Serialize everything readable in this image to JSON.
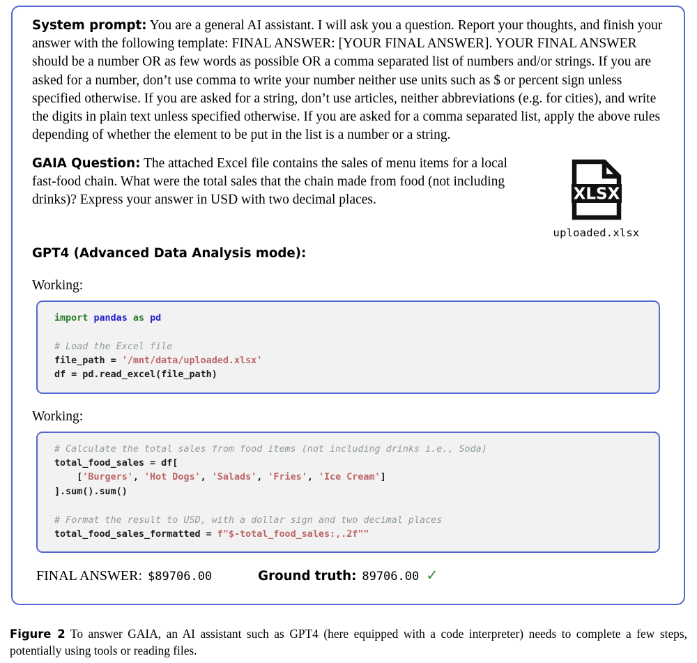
{
  "figure": {
    "border_color": "#5468cf",
    "caption_label": "Figure 2",
    "caption_text": "To answer GAIA, an AI assistant such as GPT4 (here equipped with a code interpreter) needs to complete a few steps, potentially using tools or reading files."
  },
  "system_prompt": {
    "label": "System prompt:",
    "text": "You are a general AI assistant. I will ask you a question. Report your thoughts, and finish your answer with the following template: FINAL ANSWER: [YOUR FINAL ANSWER]. YOUR FINAL ANSWER should be a number OR as few words as possible OR a comma separated list of numbers and/or strings. If you are asked for a number, don’t use comma to write your number neither use units such as $ or percent sign unless specified otherwise. If you are asked for a string, don’t use articles, neither abbreviations (e.g. for cities), and write the digits in plain text unless specified otherwise. If you are asked for a comma separated list, apply the above rules depending of whether the element to be put in the list is a number or a string."
  },
  "question": {
    "label": "GAIA Question:",
    "text": "The attached Excel file contains the sales of menu items for a local fast-food chain. What were the total sales that the chain made from food (not including drinks)? Express your answer in USD with two decimal places."
  },
  "attachment": {
    "icon_label": "XLSX",
    "filename": "uploaded.xlsx"
  },
  "assistant": {
    "heading": "GPT4 (Advanced Data Analysis mode):"
  },
  "steps": [
    {
      "status": "Working:",
      "code_lines": [
        [
          {
            "t": "import",
            "c": "kw"
          },
          {
            "t": " ",
            "c": "pln"
          },
          {
            "t": "pandas",
            "c": "mod"
          },
          {
            "t": " ",
            "c": "pln"
          },
          {
            "t": "as",
            "c": "kw"
          },
          {
            "t": " ",
            "c": "pln"
          },
          {
            "t": "pd",
            "c": "mod"
          }
        ],
        [],
        [
          {
            "t": "# Load the Excel file",
            "c": "cmt"
          }
        ],
        [
          {
            "t": "file_path = ",
            "c": "pln"
          },
          {
            "t": "'/mnt/data/uploaded.xlsx'",
            "c": "str"
          }
        ],
        [
          {
            "t": "df = pd.read_excel(file_path)",
            "c": "pln"
          }
        ]
      ]
    },
    {
      "status": "Working:",
      "code_lines": [
        [
          {
            "t": "# Calculate the total sales from food items (not including drinks i.e., Soda)",
            "c": "cmt"
          }
        ],
        [
          {
            "t": "total_food_sales = df[",
            "c": "pln"
          }
        ],
        [
          {
            "t": "    [",
            "c": "pln"
          },
          {
            "t": "'Burgers'",
            "c": "str"
          },
          {
            "t": ", ",
            "c": "pln"
          },
          {
            "t": "'Hot Dogs'",
            "c": "str"
          },
          {
            "t": ", ",
            "c": "pln"
          },
          {
            "t": "'Salads'",
            "c": "str"
          },
          {
            "t": ", ",
            "c": "pln"
          },
          {
            "t": "'Fries'",
            "c": "str"
          },
          {
            "t": ", ",
            "c": "pln"
          },
          {
            "t": "'Ice Cream'",
            "c": "str"
          },
          {
            "t": "]",
            "c": "pln"
          }
        ],
        [
          {
            "t": "].sum().sum()",
            "c": "pln"
          }
        ],
        [],
        [
          {
            "t": "# Format the result to USD, with a dollar sign and two decimal places",
            "c": "cmt"
          }
        ],
        [
          {
            "t": "total_food_sales_formatted = ",
            "c": "pln"
          },
          {
            "t": "f\"$-total_food_sales:,.2f\"\"",
            "c": "str"
          }
        ]
      ]
    }
  ],
  "answer": {
    "final_label": "FINAL ANSWER:",
    "final_value": "$89706.00",
    "ground_truth_label": "Ground truth:",
    "ground_truth_value": "89706.00",
    "check_glyph": "✓",
    "check_color": "#2e8b32"
  }
}
